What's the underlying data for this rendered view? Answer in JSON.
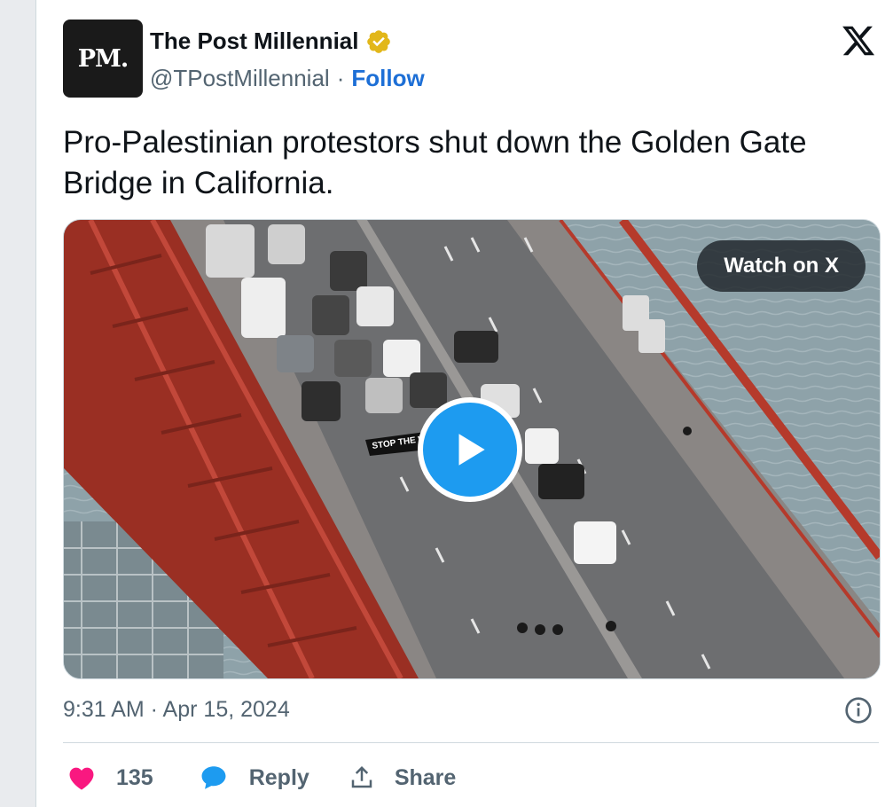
{
  "author": {
    "avatar_text": "PM.",
    "name": "The Post Millennial",
    "handle": "@TPostMillennial",
    "separator": "·",
    "follow_label": "Follow"
  },
  "tweet": {
    "text": "Pro-Palestinian protestors shut down the Golden Gate Bridge in California.",
    "banner_text": "STOP THE W"
  },
  "media": {
    "watch_label": "Watch on X"
  },
  "meta": {
    "timestamp": "9:31 AM · Apr 15, 2024"
  },
  "actions": {
    "like_count": "135",
    "reply_label": "Reply",
    "share_label": "Share"
  },
  "colors": {
    "accent": "#1d9bf0",
    "follow": "#1d6fd6",
    "like": "#f91880",
    "verified_gold": "#e2b719",
    "bridge_red": "#b53a2b"
  }
}
